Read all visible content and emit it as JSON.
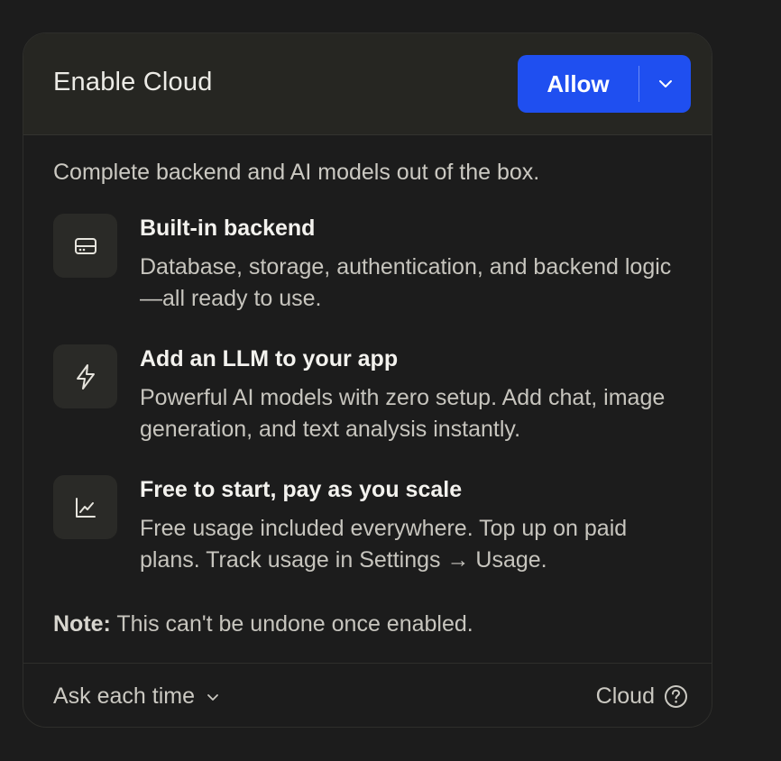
{
  "dialog": {
    "title": "Enable Cloud",
    "allow_label": "Allow",
    "intro": "Complete backend and AI models out of the box.",
    "features": [
      {
        "icon": "server-icon",
        "title": "Built-in backend",
        "description": "Database, storage, authentication, and backend logic—all ready to use."
      },
      {
        "icon": "lightning-icon",
        "title": "Add an LLM to your app",
        "description": "Powerful AI models with zero setup. Add chat, image generation, and text analysis instantly."
      },
      {
        "icon": "chart-icon",
        "title": "Free to start, pay as you scale",
        "description": "Free usage included everywhere. Top up on paid plans. Track usage in Settings → Usage."
      }
    ],
    "note_label": "Note:",
    "note_text": " This can't be undone once enabled.",
    "footer": {
      "permission_select": "Ask each time",
      "cloud_link": "Cloud"
    }
  },
  "colors": {
    "accent": "#1f4ff0",
    "background": "#1c1c1c",
    "header": "#262622"
  }
}
